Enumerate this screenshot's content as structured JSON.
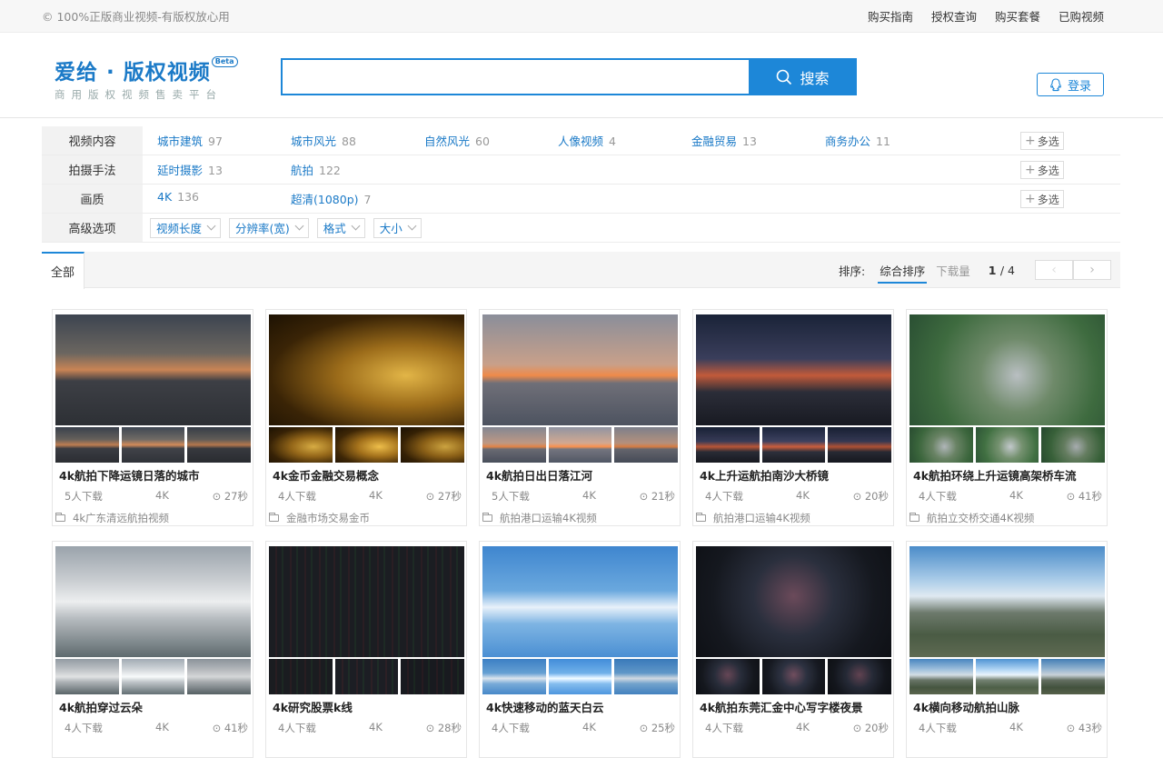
{
  "topbar": {
    "copyright": "© 100%正版商业视频-有版权放心用",
    "links": [
      "购买指南",
      "授权查询",
      "购买套餐",
      "已购视频"
    ]
  },
  "header": {
    "brand": "爱给 · 版权视频",
    "beta": "Beta",
    "slogan": "商用版权视频售卖平台",
    "search_placeholder": "",
    "search_button": "搜索",
    "login": "登录",
    "accent": "#1d87d8"
  },
  "filters": {
    "rows": [
      {
        "label": "视频内容",
        "multi": "多选",
        "options": [
          {
            "name": "城市建筑",
            "count": "97"
          },
          {
            "name": "城市风光",
            "count": "88"
          },
          {
            "name": "自然风光",
            "count": "60"
          },
          {
            "name": "人像视频",
            "count": "4"
          },
          {
            "name": "金融贸易",
            "count": "13"
          },
          {
            "name": "商务办公",
            "count": "11"
          }
        ]
      },
      {
        "label": "拍摄手法",
        "multi": "多选",
        "options": [
          {
            "name": "延时摄影",
            "count": "13"
          },
          {
            "name": "航拍",
            "count": "122"
          }
        ]
      },
      {
        "label": "画质",
        "multi": "多选",
        "options": [
          {
            "name": "4K",
            "count": "136"
          },
          {
            "name": "超清(1080p)",
            "count": "7"
          }
        ]
      }
    ],
    "advanced": {
      "label": "高级选项",
      "dropdowns": [
        "视频长度",
        "分辨率(宽)",
        "格式",
        "大小"
      ]
    }
  },
  "tabs": {
    "all": "全部",
    "sort_label": "排序:",
    "sort_options": [
      "综合排序",
      "下载量"
    ],
    "page_current": "1",
    "page_total": "/ 4",
    "prev": "‹",
    "next": "›"
  },
  "videos": [
    {
      "title": "4k航拍下降运镜日落的城市",
      "downloads": "5人下载",
      "quality": "4K",
      "duration": "27秒",
      "category": "4k广东清远航拍视频",
      "theme": "sunset-city"
    },
    {
      "title": "4k金币金融交易概念",
      "downloads": "4人下载",
      "quality": "4K",
      "duration": "27秒",
      "category": "金融市场交易金币",
      "theme": "gold-coins"
    },
    {
      "title": "4k航拍日出日落江河",
      "downloads": "5人下载",
      "quality": "4K",
      "duration": "21秒",
      "category": "航拍港口运输4K视频",
      "theme": "river-sunset"
    },
    {
      "title": "4k上升运航拍南沙大桥镜",
      "downloads": "4人下载",
      "quality": "4K",
      "duration": "20秒",
      "category": "航拍港口运输4K视频",
      "theme": "bridge-night"
    },
    {
      "title": "4k航拍环绕上升运镜高架桥车流",
      "downloads": "4人下载",
      "quality": "4K",
      "duration": "41秒",
      "category": "航拍立交桥交通4K视频",
      "theme": "interchange"
    },
    {
      "title": "4k航拍穿过云朵",
      "downloads": "4人下载",
      "quality": "4K",
      "duration": "41秒",
      "category": "",
      "theme": "clouds"
    },
    {
      "title": "4k研究股票k线",
      "downloads": "4人下载",
      "quality": "4K",
      "duration": "28秒",
      "category": "",
      "theme": "stock"
    },
    {
      "title": "4k快速移动的蓝天白云",
      "downloads": "4人下载",
      "quality": "4K",
      "duration": "25秒",
      "category": "",
      "theme": "blue-sky"
    },
    {
      "title": "4k航拍东莞汇金中心写字楼夜景",
      "downloads": "4人下载",
      "quality": "4K",
      "duration": "20秒",
      "category": "",
      "theme": "city-night"
    },
    {
      "title": "4k横向移动航拍山脉",
      "downloads": "4人下载",
      "quality": "4K",
      "duration": "43秒",
      "category": "",
      "theme": "mountains"
    }
  ]
}
